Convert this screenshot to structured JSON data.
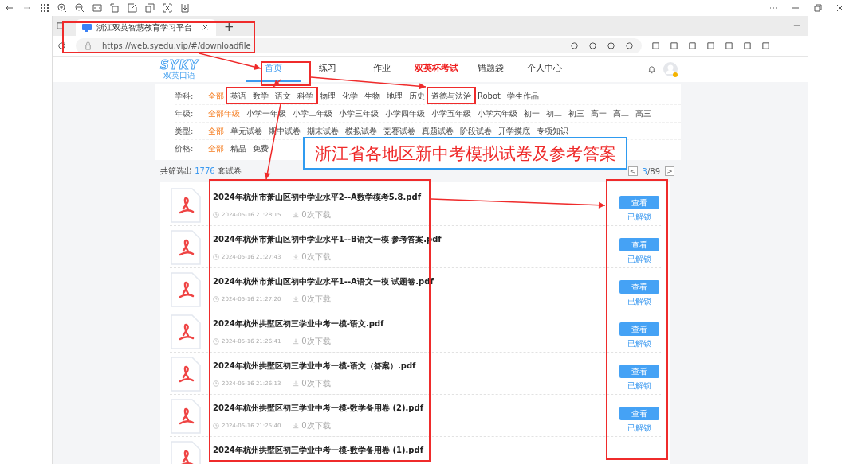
{
  "browser": {
    "tab_title": "浙江双英智慧教育学习平台",
    "new_tab": "+",
    "url": "https://web.syedu.vip/#/downloadfile"
  },
  "site": {
    "logo": "SYKY",
    "logo_sub": "双英口语",
    "nav": [
      {
        "label": "首页",
        "selected": true,
        "kind": "normal"
      },
      {
        "label": "练习",
        "selected": false,
        "kind": "normal"
      },
      {
        "label": "作业",
        "selected": false,
        "kind": "normal"
      },
      {
        "label": "双英杯考试",
        "selected": false,
        "kind": "highlight"
      },
      {
        "label": "错题袋",
        "selected": false,
        "kind": "normal"
      },
      {
        "label": "个人中心",
        "selected": false,
        "kind": "normal"
      }
    ]
  },
  "filters": [
    {
      "label": "学科:",
      "options": [
        {
          "text": "全部",
          "selected": true
        },
        {
          "text": "英语",
          "selected": false
        },
        {
          "text": "数学",
          "selected": false
        },
        {
          "text": "语文",
          "selected": false
        },
        {
          "text": "科学",
          "selected": false
        },
        {
          "text": "物理",
          "selected": false
        },
        {
          "text": "化学",
          "selected": false
        },
        {
          "text": "生物",
          "selected": false
        },
        {
          "text": "地理",
          "selected": false
        },
        {
          "text": "历史",
          "selected": false
        },
        {
          "text": "道德与法治",
          "selected": false
        },
        {
          "text": "Robot",
          "selected": false
        },
        {
          "text": "学生作品",
          "selected": false
        }
      ]
    },
    {
      "label": "年级:",
      "options": [
        {
          "text": "全部年级",
          "selected": true
        },
        {
          "text": "小学一年级",
          "selected": false
        },
        {
          "text": "小学二年级",
          "selected": false
        },
        {
          "text": "小学三年级",
          "selected": false
        },
        {
          "text": "小学四年级",
          "selected": false
        },
        {
          "text": "小学五年级",
          "selected": false
        },
        {
          "text": "小学六年级",
          "selected": false
        },
        {
          "text": "初一",
          "selected": false
        },
        {
          "text": "初二",
          "selected": false
        },
        {
          "text": "初三",
          "selected": false
        },
        {
          "text": "高一",
          "selected": false
        },
        {
          "text": "高二",
          "selected": false
        },
        {
          "text": "高三",
          "selected": false
        }
      ]
    },
    {
      "label": "类型:",
      "options": [
        {
          "text": "全部",
          "selected": true
        },
        {
          "text": "单元试卷",
          "selected": false
        },
        {
          "text": "期中试卷",
          "selected": false
        },
        {
          "text": "期末试卷",
          "selected": false
        },
        {
          "text": "模拟试卷",
          "selected": false
        },
        {
          "text": "竞赛试卷",
          "selected": false
        },
        {
          "text": "真题试卷",
          "selected": false
        },
        {
          "text": "阶段试卷",
          "selected": false
        },
        {
          "text": "开学摸底",
          "selected": false
        },
        {
          "text": "专项知识",
          "selected": false
        }
      ]
    },
    {
      "label": "价格:",
      "options": [
        {
          "text": "全部",
          "selected": true
        },
        {
          "text": "精品",
          "selected": false
        },
        {
          "text": "免费",
          "selected": false
        }
      ]
    }
  ],
  "summary": {
    "prefix": "共筛选出",
    "count": "1776",
    "suffix": "套试卷"
  },
  "pager": {
    "prev": "<",
    "current": "3",
    "total": "/89",
    "next": ">"
  },
  "callout": "浙江省各地区新中考模拟试卷及参考答案",
  "files": [
    {
      "title": "2024年杭州市萧山区初中学业水平2--A数学模考5.8.pdf",
      "time": "2024-05-16 21:28:15",
      "downloads": "0次下载",
      "button": "查看",
      "status": "已解锁"
    },
    {
      "title": "2024年杭州市萧山区初中学业水平1--B语文一模 参考答案.pdf",
      "time": "2024-05-16 21:27:43",
      "downloads": "0次下载",
      "button": "查看",
      "status": "已解锁"
    },
    {
      "title": "2024年杭州市萧山区初中学业水平1--A语文一模 试题卷.pdf",
      "time": "2024-05-16 21:27:20",
      "downloads": "0次下载",
      "button": "查看",
      "status": "已解锁"
    },
    {
      "title": "2024年杭州拱墅区初三学业中考一模-语文.pdf",
      "time": "2024-05-16 21:26:41",
      "downloads": "0次下载",
      "button": "查看",
      "status": "已解锁"
    },
    {
      "title": "2024年杭州拱墅区初三学业中考一模-语文（答案）.pdf",
      "time": "2024-05-16 21:26:13",
      "downloads": "0次下载",
      "button": "查看",
      "status": "已解锁"
    },
    {
      "title": "2024年杭州拱墅区初三学业中考一模-数学备用卷 (2).pdf",
      "time": "2024-05-16 21:25:40",
      "downloads": "0次下载",
      "button": "查看",
      "status": "已解锁"
    },
    {
      "title": "2024年杭州拱墅区初三学业中考一模-数学备用卷 (1).pdf"
    }
  ]
}
